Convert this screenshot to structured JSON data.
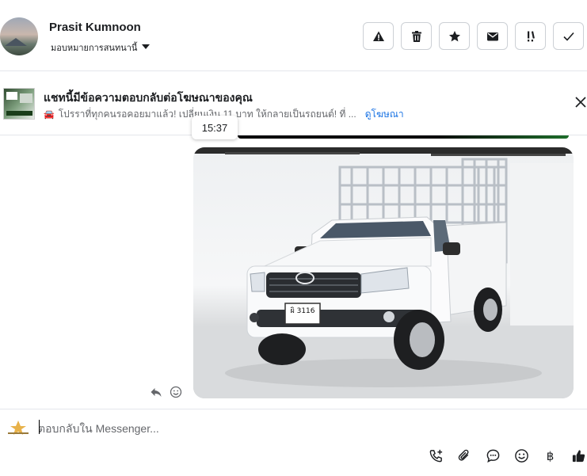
{
  "header": {
    "contact_name": "Prasit Kumnoon",
    "assign_label": "มอบหมายการสนทนานี้",
    "actions": [
      {
        "icon": "alert-triangle-icon"
      },
      {
        "icon": "trash-icon"
      },
      {
        "icon": "star-icon"
      },
      {
        "icon": "envelope-icon"
      },
      {
        "icon": "follow-up-icon",
        "text": "!!"
      },
      {
        "icon": "check-icon"
      }
    ]
  },
  "ad_banner": {
    "title": "แชทนี้มีข้อความตอบกลับต่อโฆษณาของคุณ",
    "car_emoji": "🚘",
    "subtitle": "โปรราที่ทุกคนรอคอยมาแล้ว! เปลี่ยนเงิน 11 บาท ให้กลายเป็นรถยนต์! ที่ ...",
    "link_label": "ดูโฆษณา"
  },
  "chat": {
    "timestamp": "15:37",
    "image_alt_plate": "ผิ 3116"
  },
  "composer": {
    "placeholder": "ตอบกลับใน Messenger...",
    "baht_symbol": "฿"
  },
  "colors": {
    "link": "#1b74e4",
    "border": "#ccd0d5",
    "text": "#1c1e21",
    "muted": "#65676b"
  }
}
